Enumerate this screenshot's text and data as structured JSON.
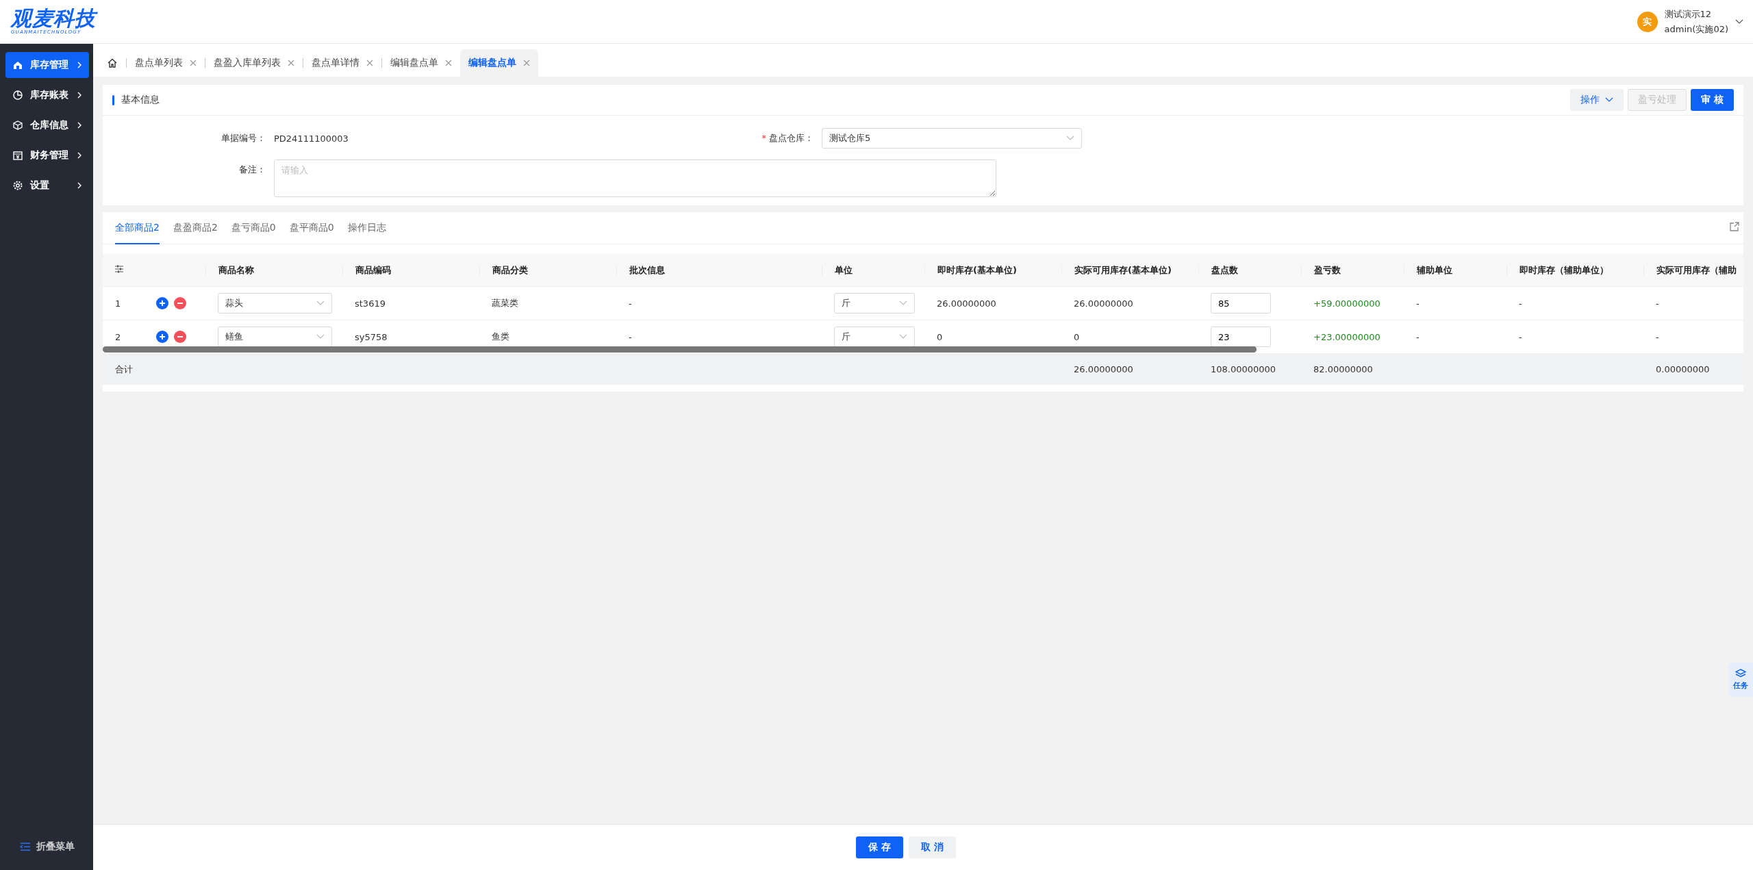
{
  "logo": {
    "name": "观麦科技",
    "subtitle": "GUANMAITECHNOLOGY"
  },
  "user": {
    "avatar": "实",
    "name": "测试演示12",
    "account": "admin(实施02)"
  },
  "sidebar": {
    "items": [
      {
        "label": "库存管理",
        "selected": true
      },
      {
        "label": "库存账表",
        "selected": false
      },
      {
        "label": "仓库信息",
        "selected": false
      },
      {
        "label": "财务管理",
        "selected": false
      },
      {
        "label": "设置",
        "selected": false
      }
    ],
    "collapse": "折叠菜单"
  },
  "page_tabs": [
    {
      "label": "盘点单列表",
      "selected": false
    },
    {
      "label": "盘盈入库单列表",
      "selected": false
    },
    {
      "label": "盘点单详情",
      "selected": false
    },
    {
      "label": "编辑盘点单",
      "selected": false
    },
    {
      "label": "编辑盘点单",
      "selected": true
    }
  ],
  "basic_info": {
    "title": "基本信息",
    "actions": [
      {
        "label": "操作",
        "kind": "menu"
      },
      {
        "label": "盈亏处理",
        "kind": "disabled"
      },
      {
        "label": "审 核",
        "kind": "primary"
      }
    ],
    "doc_no": {
      "label": "单据编号：",
      "value": "PD24111100003"
    },
    "warehouse": {
      "label": "盘点仓库：",
      "required": true,
      "required_mark": "*",
      "value": "测试仓库5"
    },
    "remark": {
      "label": "备注：",
      "placeholder": "请输入"
    }
  },
  "product_tabs": [
    {
      "label": "全部商品2",
      "selected": true
    },
    {
      "label": "盘盈商品2",
      "selected": false
    },
    {
      "label": "盘亏商品0",
      "selected": false
    },
    {
      "label": "盘平商品0",
      "selected": false
    },
    {
      "label": "操作日志",
      "selected": false
    }
  ],
  "table": {
    "columns": [
      "商品名称",
      "商品编码",
      "商品分类",
      "批次信息",
      "单位",
      "即时库存(基本单位)",
      "实际可用库存(基本单位)",
      "盘点数",
      "盈亏数",
      "辅助单位",
      "即时库存（辅助单位）",
      "实际可用库存（辅助"
    ],
    "rows": [
      {
        "index": "1",
        "name": "蒜头",
        "code": "st3619",
        "category": "蔬菜类",
        "batch": "-",
        "unit": "斤",
        "stock": "26.00000000",
        "available": "26.00000000",
        "count": "85",
        "diff": "+59.00000000",
        "aux_unit": "-",
        "aux_stock": "-",
        "aux_available": "-"
      },
      {
        "index": "2",
        "name": "鳝鱼",
        "code": "sy5758",
        "category": "鱼类",
        "batch": "-",
        "unit": "斤",
        "stock": "0",
        "available": "0",
        "count": "23",
        "diff": "+23.00000000",
        "aux_unit": "-",
        "aux_stock": "-",
        "aux_available": "-"
      }
    ],
    "totals": {
      "label": "合计",
      "available": "26.00000000",
      "count": "108.00000000",
      "diff": "82.00000000",
      "aux_available": "0.00000000"
    }
  },
  "footer_buttons": [
    {
      "label": "保 存",
      "kind": "primary"
    },
    {
      "label": "取 消",
      "kind": "default"
    }
  ],
  "task_widget": {
    "label": "任务"
  }
}
